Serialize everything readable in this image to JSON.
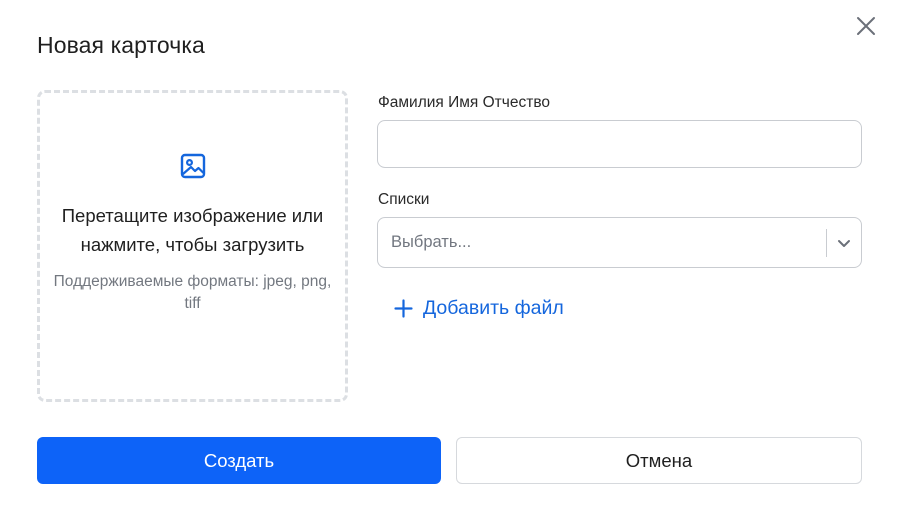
{
  "modal": {
    "title": "Новая карточка"
  },
  "dropzone": {
    "main_text": "Перетащите изображение или нажмите, чтобы загрузить",
    "hint_text": "Поддерживаемые форматы: jpeg, png, tiff"
  },
  "form": {
    "fio_label": "Фамилия Имя Отчество",
    "fio_value": "",
    "lists_label": "Списки",
    "lists_placeholder": "Выбрать..."
  },
  "actions": {
    "add_file_label": "Добавить файл",
    "create_label": "Создать",
    "cancel_label": "Отмена"
  },
  "colors": {
    "primary": "#0d63f8",
    "link": "#1466dd",
    "border": "#c9ccd1",
    "dashed_border": "#dcdfe3"
  },
  "icons": {
    "close": "close-icon",
    "upload_image": "image-icon",
    "dropdown": "chevron-down-icon",
    "add": "plus-icon"
  }
}
